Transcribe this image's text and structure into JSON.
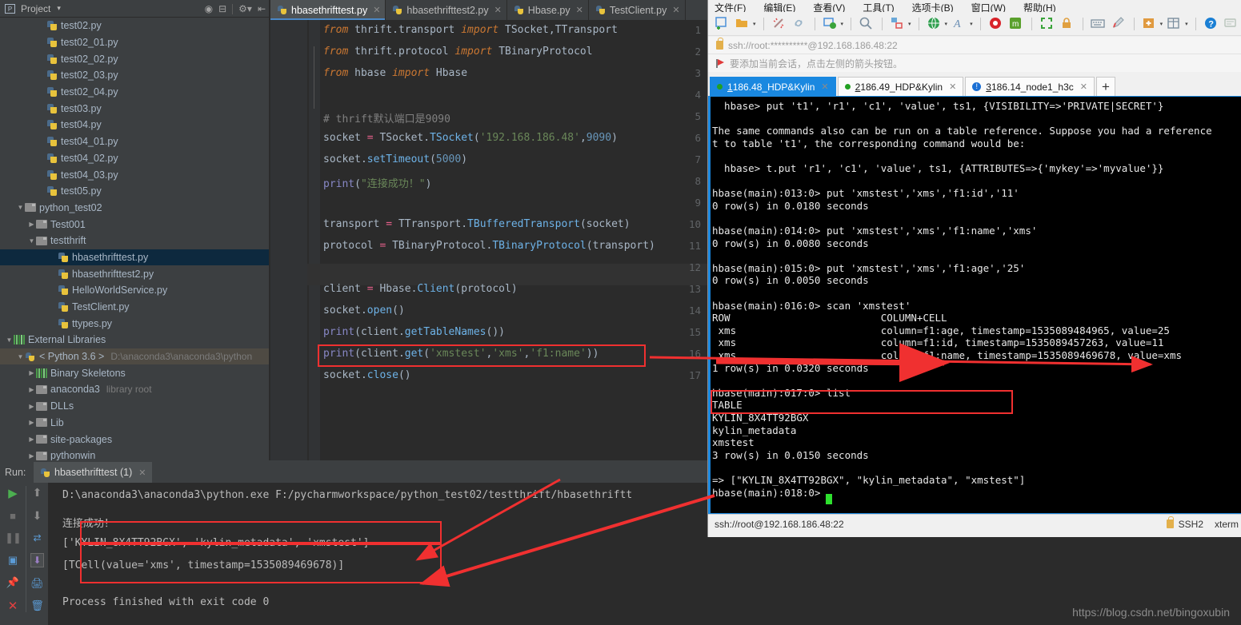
{
  "ide": {
    "project_panel": {
      "title": "Project",
      "caret": "▾",
      "icons": [
        "project-view-icon",
        "target-icon",
        "collapse-all-icon",
        "gear-icon",
        "hide-icon"
      ]
    },
    "tree": [
      {
        "label": "test02.py",
        "type": "py",
        "indent": 3,
        "arrow": ""
      },
      {
        "label": "test02_01.py",
        "type": "py",
        "indent": 3,
        "arrow": ""
      },
      {
        "label": "test02_02.py",
        "type": "py",
        "indent": 3,
        "arrow": ""
      },
      {
        "label": "test02_03.py",
        "type": "py",
        "indent": 3,
        "arrow": ""
      },
      {
        "label": "test02_04.py",
        "type": "py",
        "indent": 3,
        "arrow": ""
      },
      {
        "label": "test03.py",
        "type": "py",
        "indent": 3,
        "arrow": ""
      },
      {
        "label": "test04.py",
        "type": "py",
        "indent": 3,
        "arrow": ""
      },
      {
        "label": "test04_01.py",
        "type": "py",
        "indent": 3,
        "arrow": ""
      },
      {
        "label": "test04_02.py",
        "type": "py",
        "indent": 3,
        "arrow": ""
      },
      {
        "label": "test04_03.py",
        "type": "py",
        "indent": 3,
        "arrow": ""
      },
      {
        "label": "test05.py",
        "type": "py",
        "indent": 3,
        "arrow": ""
      },
      {
        "label": "python_test02",
        "type": "folder",
        "indent": 1,
        "arrow": "▼"
      },
      {
        "label": "Test001",
        "type": "folder",
        "indent": 2,
        "arrow": "▶"
      },
      {
        "label": "testthrift",
        "type": "folder",
        "indent": 2,
        "arrow": "▼"
      },
      {
        "label": "hbasethrifttest.py",
        "type": "py",
        "indent": 4,
        "arrow": "",
        "state": "selected"
      },
      {
        "label": "hbasethrifttest2.py",
        "type": "py",
        "indent": 4,
        "arrow": ""
      },
      {
        "label": "HelloWorldService.py",
        "type": "py",
        "indent": 4,
        "arrow": ""
      },
      {
        "label": "TestClient.py",
        "type": "py",
        "indent": 4,
        "arrow": ""
      },
      {
        "label": "ttypes.py",
        "type": "py",
        "indent": 4,
        "arrow": ""
      },
      {
        "label": "External Libraries",
        "type": "lib",
        "indent": 0,
        "arrow": "▼"
      },
      {
        "label": "< Python 3.6 >",
        "sublabel": "D:\\anaconda3\\anaconda3\\python",
        "type": "pysmall",
        "indent": 1,
        "arrow": "▼",
        "state": "highlight"
      },
      {
        "label": "Binary Skeletons",
        "type": "lib",
        "indent": 2,
        "arrow": "▶"
      },
      {
        "label": "anaconda3",
        "sublabel": "library root",
        "type": "folder",
        "indent": 2,
        "arrow": "▶"
      },
      {
        "label": "DLLs",
        "type": "folder",
        "indent": 2,
        "arrow": "▶"
      },
      {
        "label": "Lib",
        "type": "folder",
        "indent": 2,
        "arrow": "▶"
      },
      {
        "label": "site-packages",
        "type": "folder",
        "indent": 2,
        "arrow": "▶"
      },
      {
        "label": "pythonwin",
        "type": "folder",
        "indent": 2,
        "arrow": "▶"
      }
    ],
    "editor_tabs": [
      {
        "label": "hbasethrifttest.py",
        "active": true
      },
      {
        "label": "hbasethrifttest2.py",
        "active": false
      },
      {
        "label": "Hbase.py",
        "active": false
      },
      {
        "label": "TestClient.py",
        "active": false
      }
    ],
    "code_lines": [
      {
        "n": "1",
        "text": "from thrift.transport import TSocket,TTransport"
      },
      {
        "n": "2",
        "text": "from thrift.protocol import TBinaryProtocol"
      },
      {
        "n": "3",
        "text": "from hbase import Hbase"
      },
      {
        "n": "4",
        "text": ""
      },
      {
        "n": "5",
        "text": "# thrift默认端口是9090"
      },
      {
        "n": "6",
        "text": "socket = TSocket.TSocket('192.168.186.48',9090)"
      },
      {
        "n": "7",
        "text": "socket.setTimeout(5000)"
      },
      {
        "n": "8",
        "text": "print(\"连接成功！\")"
      },
      {
        "n": "9",
        "text": ""
      },
      {
        "n": "10",
        "text": "transport = TTransport.TBufferedTransport(socket)"
      },
      {
        "n": "11",
        "text": "protocol = TBinaryProtocol.TBinaryProtocol(transport)"
      },
      {
        "n": "12",
        "text": ""
      },
      {
        "n": "13",
        "text": "client = Hbase.Client(protocol)"
      },
      {
        "n": "14",
        "text": "socket.open()"
      },
      {
        "n": "15",
        "text": "print(client.getTableNames())"
      },
      {
        "n": "16",
        "text": "print(client.get('xmstest','xms','f1:name'))"
      },
      {
        "n": "17",
        "text": "socket.close()"
      }
    ],
    "run_panel": {
      "run_label": "Run:",
      "tab_label": "hbasethrifttest (1)",
      "console_lines": [
        "D:\\anaconda3\\anaconda3\\python.exe F:/pycharmworkspace/python_test02/testthrift/hbasethriftt",
        "连接成功！",
        "['KYLIN_8X4TT92BGX', 'kylin_metadata', 'xmstest']",
        "[TCell(value='xms', timestamp=1535089469678)]",
        "Process finished with exit code 0"
      ],
      "side_icons_col1": [
        "run-icon",
        "stop-icon",
        "pause-icon",
        "print-layout-icon",
        "pin-icon",
        "close-icon"
      ],
      "side_icons_col2": [
        "scroll-up-icon",
        "scroll-down-icon",
        "soft-wrap-icon",
        "scroll-to-end-icon",
        "print-icon",
        "trash-icon"
      ]
    }
  },
  "xshell": {
    "menu": [
      "文件(F)",
      "编辑(E)",
      "查看(V)",
      "工具(T)",
      "选项卡(B)",
      "窗口(W)",
      "帮助(H)"
    ],
    "toolbar_icons": [
      "new-session-icon",
      "open-folder-icon",
      "disconnect-icon",
      "link-icon",
      "session-properties-icon",
      "find-icon",
      "transfer-icon",
      "globe-icon",
      "font-icon",
      "spiral-icon",
      "script-icon",
      "fullscreen-icon",
      "lock-icon",
      "keyboard-icon",
      "highlight-pen-icon",
      "new-tab-icon",
      "layout-icon",
      "help-icon",
      "comment-icon"
    ],
    "address": "ssh://root:**********@192.168.186.48:22",
    "note": "要添加当前会话，点击左侧的箭头按钮。",
    "tabs": [
      {
        "num": "1",
        "label": "186.48_HDP&Kylin",
        "active": true,
        "status": "green"
      },
      {
        "num": "2",
        "label": "186.49_HDP&Kylin",
        "active": false,
        "status": "green"
      },
      {
        "num": "3",
        "label": "186.14_node1_h3c",
        "active": false,
        "status": "alert"
      }
    ],
    "add_tab": "+",
    "terminal_lines": [
      "  hbase> put 't1', 'r1', 'c1', 'value', ts1, {VISIBILITY=>'PRIVATE|SECRET'}",
      "",
      "The same commands also can be run on a table reference. Suppose you had a reference",
      "t to table 't1', the corresponding command would be:",
      "",
      "  hbase> t.put 'r1', 'c1', 'value', ts1, {ATTRIBUTES=>{'mykey'=>'myvalue'}}",
      "",
      "hbase(main):013:0> put 'xmstest','xms','f1:id','11'",
      "0 row(s) in 0.0180 seconds",
      "",
      "hbase(main):014:0> put 'xmstest','xms','f1:name','xms'",
      "0 row(s) in 0.0080 seconds",
      "",
      "hbase(main):015:0> put 'xmstest','xms','f1:age','25'",
      "0 row(s) in 0.0050 seconds",
      "",
      "hbase(main):016:0> scan 'xmstest'",
      "ROW                         COLUMN+CELL",
      " xms                        column=f1:age, timestamp=1535089484965, value=25",
      " xms                        column=f1:id, timestamp=1535089457263, value=11",
      " xms                        column=f1:name, timestamp=1535089469678, value=xms",
      "1 row(s) in 0.0320 seconds",
      "",
      "hbase(main):017:0> list",
      "TABLE",
      "KYLIN_8X4TT92BGX",
      "kylin_metadata",
      "xmstest",
      "3 row(s) in 0.0150 seconds",
      "",
      "=> [\"KYLIN_8X4TT92BGX\", \"kylin_metadata\", \"xmstest\"]",
      "hbase(main):018:0>"
    ],
    "status": {
      "connection": "ssh://root@192.168.186.48:22",
      "security": "SSH2",
      "term": "xterm"
    }
  },
  "watermark": "https://blog.csdn.net/bingoxubin"
}
